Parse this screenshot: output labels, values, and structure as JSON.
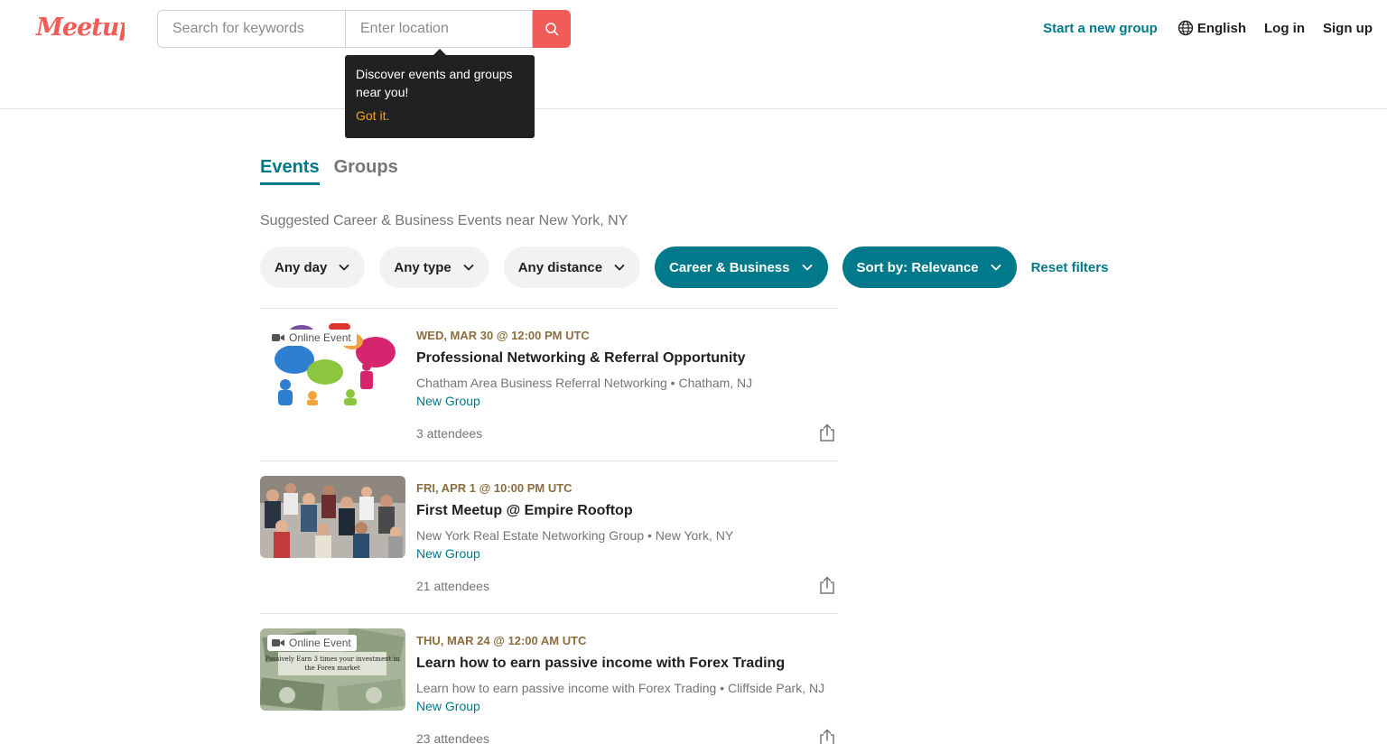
{
  "header": {
    "logo_text": "Meetup",
    "search_placeholder": "Search for keywords",
    "location_placeholder": "Enter location",
    "start_group": "Start a new group",
    "language": "English",
    "login": "Log in",
    "signup": "Sign up"
  },
  "tooltip": {
    "text": "Discover events and groups near you!",
    "link": "Got it."
  },
  "tabs": [
    {
      "label": "Events",
      "active": true
    },
    {
      "label": "Groups",
      "active": false
    }
  ],
  "subtitle": "Suggested Career & Business Events near New York, NY",
  "filters": [
    {
      "label": "Any day",
      "active": false
    },
    {
      "label": "Any type",
      "active": false
    },
    {
      "label": "Any distance",
      "active": false
    },
    {
      "label": "Career & Business",
      "active": true
    },
    {
      "label": "Sort by: Relevance",
      "active": true
    }
  ],
  "reset_filters": "Reset filters",
  "events": [
    {
      "date": "WED, MAR 30 @ 12:00 PM UTC",
      "title": "Professional Networking & Referral Opportunity",
      "group": "Chatham Area Business Referral Networking • Chatham, NJ",
      "new_group": "New Group",
      "attendees": "3 attendees",
      "badge": "Online Event"
    },
    {
      "date": "FRI, APR 1 @ 10:00 PM UTC",
      "title": "First Meetup @ Empire Rooftop",
      "group": "New York Real Estate Networking Group • New York, NY",
      "new_group": "New Group",
      "attendees": "21 attendees",
      "badge": ""
    },
    {
      "date": "THU, MAR 24 @ 12:00 AM UTC",
      "title": "Learn how to earn passive income with Forex Trading",
      "group": "Learn how to earn passive income with Forex Trading • Cliffside Park, NJ",
      "new_group": "New Group",
      "attendees": "23 attendees",
      "badge": "Online Event",
      "image_text": "Passively Earn 3 times your investment in the Forex market"
    }
  ],
  "colors": {
    "brand": "#f15b58",
    "teal": "#00798a",
    "date": "#8c6d3f"
  }
}
